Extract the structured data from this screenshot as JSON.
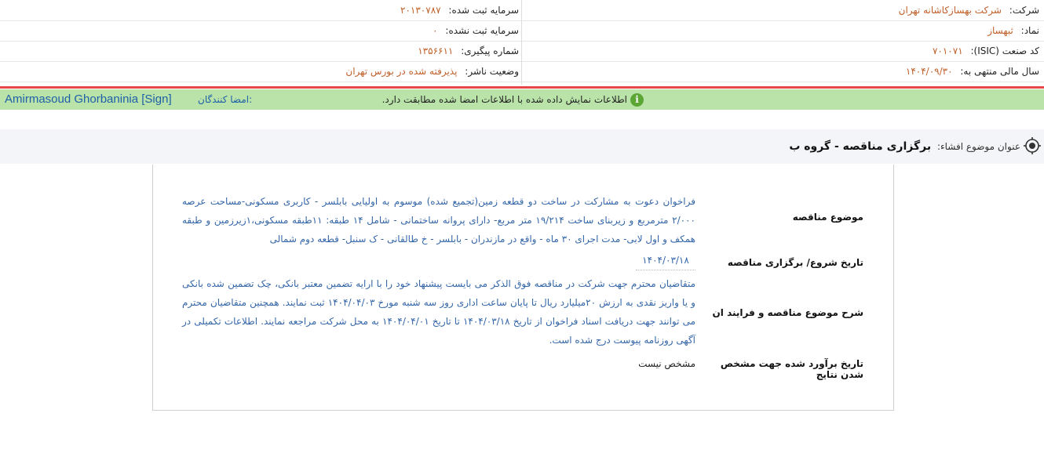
{
  "header": {
    "company_label": "شرکت:",
    "company_value": "شرکت بهسازکاشانه تهران",
    "registered_capital_label": "سرمایه ثبت شده:",
    "registered_capital_value": "۲۰۱۳۰۷۸۷",
    "symbol_label": "نماد:",
    "symbol_value": "ثبهساز",
    "unregistered_capital_label": "سرمایه ثبت نشده:",
    "unregistered_capital_value": "۰",
    "isic_label": "کد صنعت (ISIC):",
    "isic_value": "۷۰۱۰۷۱",
    "tracking_label": "شماره پیگیری:",
    "tracking_value": "۱۳۵۶۶۱۱",
    "fiscal_year_label": "سال مالی منتهی به:",
    "fiscal_year_value": "۱۴۰۴/۰۹/۳۰",
    "publisher_status_label": "وضعیت ناشر:",
    "publisher_status_value": "پذیرفته شده در بورس تهران"
  },
  "signature": {
    "message": "اطلاعات نمایش داده شده با اطلاعات امضا شده مطابقت دارد.",
    "signers_label": "امضا کنندگان:",
    "signer_name": "Amirmasoud Ghorbaninia [Sign]"
  },
  "disclosure": {
    "title_label": "عنوان موضوع افشاء:",
    "title_value": "برگزاری مناقصه - گروه ب"
  },
  "fields": {
    "subject_label": "موضوع مناقصه",
    "subject_value": "فراخوان دعوت به مشارکت در ساخت دو قطعه زمین(تجمیع شده) موسوم به اولیایی بابلسر - کاربری مسکونی-مساحت عرصه ۲/۰۰۰ مترمربع و زیربنای ساخت ۱۹/۲۱۴ متر مربع- دارای پروانه ساختمانی - شامل ۱۴ طبقه: ۱۱طبقه مسکونی،۱زیرزمین و طبقه همکف و اول لابی- مدت اجرای ۳۰ ماه - واقع در مازندران - بابلسر - خ طالقانی - ک سنبل- قطعه دوم شمالی",
    "start_date_label": "تاریخ شروع/ برگزاری مناقصه",
    "start_date_value": "۱۴۰۴/۰۳/۱۸",
    "description_label": "شرح موضوع مناقصه و فرایند ان",
    "description_value": "متقاضیان محترم جهت شرکت در مناقصه فوق الذکر می بایست پیشنهاد خود را با ارایه تضمین معتبر بانکی، چک تضمین شده بانکی و یا واریز نقدی به ارزش ۲۰میلیارد ریال تا پایان ساعت اداری روز سه شنبه مورخ ۱۴۰۴/۰۴/۰۳ ثبت نمایند. همچنین متقاضیان محترم می توانند جهت دریافت اسناد فراخوان از تاریخ ۱۴۰۴/۰۳/۱۸ تا تاریخ ۱۴۰۴/۰۴/۰۱ به محل شرکت مراجعه نمایند. اطلاعات تکمیلی در آگهی روزنامه پیوست درج شده است.",
    "result_date_label": "تاریخ برآورد شده جهت مشخص شدن نتایج",
    "result_date_value": "مشخص نیست"
  },
  "colors": {
    "value_orange": "#c0602a",
    "signature_green": "#b9e3a9",
    "alert_red": "#e8474a",
    "link_blue": "#1f5fa8"
  }
}
